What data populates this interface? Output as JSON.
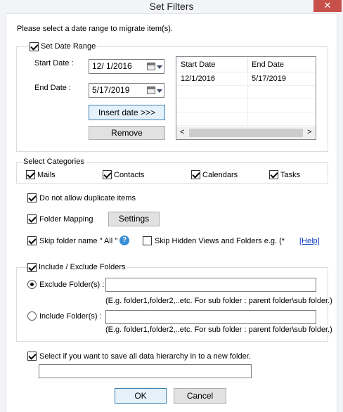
{
  "window": {
    "title": "Set Filters",
    "close_glyph": "✕"
  },
  "intro": "Please select a date range to migrate item(s).",
  "date_range": {
    "legend": "Set Date Range",
    "checked": true,
    "start_label": "Start Date :",
    "start_value": "12/ 1/2016",
    "end_label": "End Date :",
    "end_value": "5/17/2019",
    "insert_button": "Insert date >>>",
    "remove_button": "Remove",
    "table": {
      "columns": [
        "Start Date",
        "End Date"
      ],
      "rows": [
        [
          "12/1/2016",
          "5/17/2019"
        ]
      ]
    }
  },
  "categories": {
    "legend": "Select Categories",
    "items": [
      {
        "label": "Mails",
        "checked": true
      },
      {
        "label": "Contacts",
        "checked": true
      },
      {
        "label": "Calendars",
        "checked": true
      },
      {
        "label": "Tasks",
        "checked": true
      }
    ]
  },
  "options": {
    "no_duplicates": "Do not allow duplicate items",
    "folder_mapping": "Folder Mapping",
    "settings_button": "Settings",
    "skip_all": "Skip folder name \" All \"",
    "skip_hidden": "Skip Hidden Views and Folders e.g. (*",
    "help_link": "[Help]"
  },
  "folders": {
    "legend": "Include / Exclude Folders",
    "exclude_label": "Exclude Folder(s) :",
    "include_label": "Include Folder(s) :",
    "exclude_hint": "(E.g. folder1,folder2,..etc. For sub folder : parent folder\\sub folder.)",
    "include_hint": "(E.g. folder1,folder2,..etc. For sub folder : parent folder\\sub folder.)"
  },
  "hierarchy": {
    "label": "Select if you want to save all data hierarchy in to a new folder."
  },
  "footer": {
    "ok": "OK",
    "cancel": "Cancel"
  }
}
